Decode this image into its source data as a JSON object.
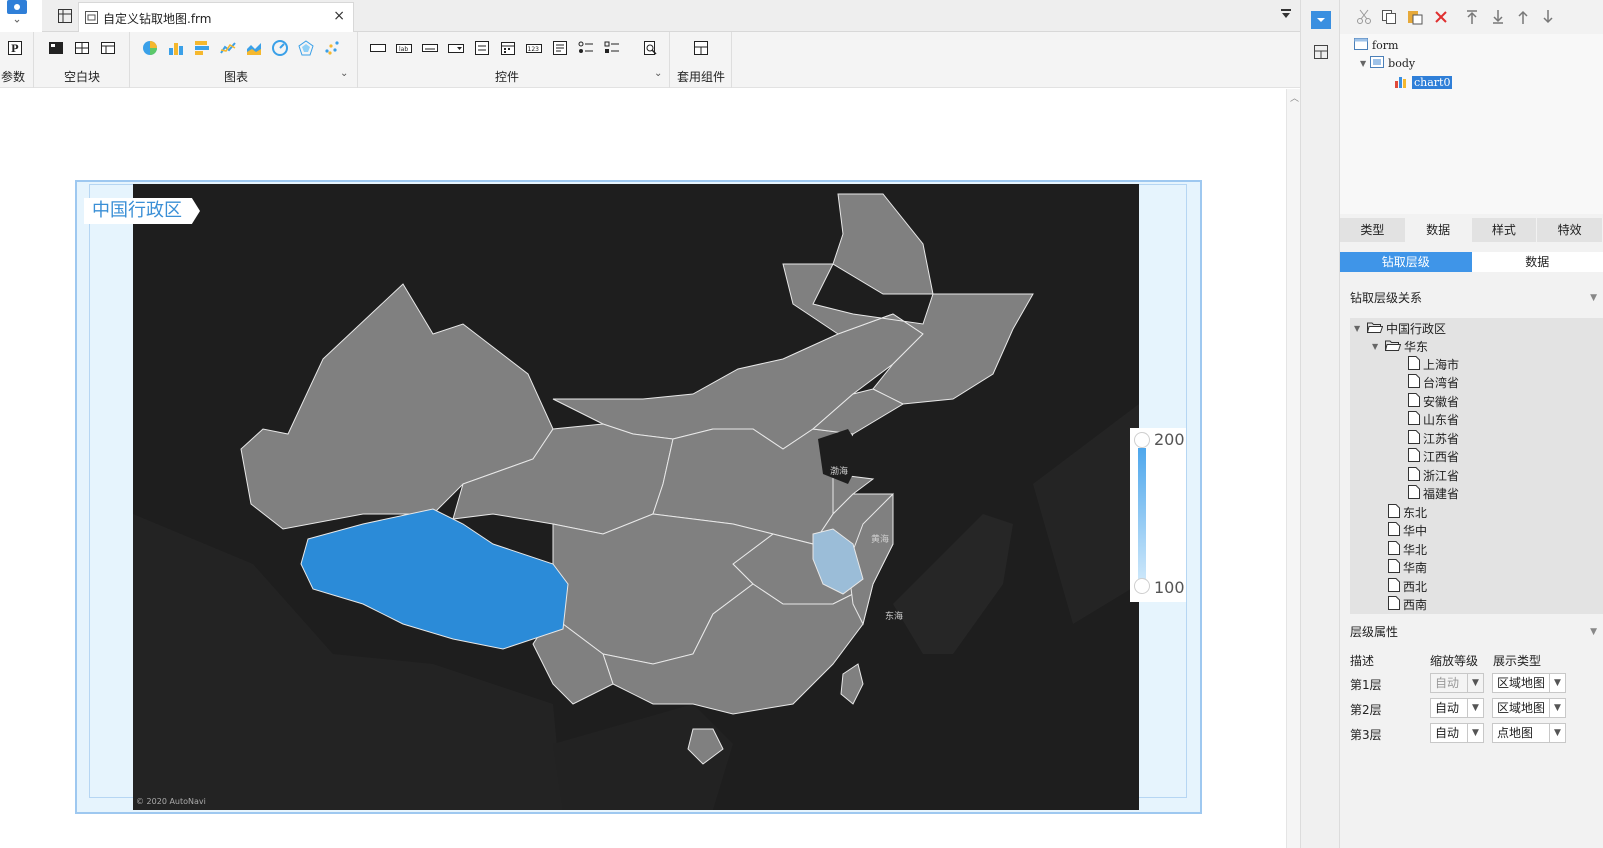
{
  "tab": {
    "title": "自定义钻取地图.frm",
    "close": "×"
  },
  "toolbar": {
    "groups": [
      {
        "label": "参数"
      },
      {
        "label": "空白块"
      },
      {
        "label": "图表",
        "caret": "⌄"
      },
      {
        "label": "控件",
        "caret": "⌄"
      },
      {
        "label": "套用组件"
      }
    ]
  },
  "map": {
    "title": "中国行政区",
    "seas": [
      "渤海",
      "黄海",
      "东海"
    ],
    "footer": "© 2020 AutoNavi",
    "legend": {
      "max": "200",
      "min": "100"
    },
    "colors": {
      "background": "#1e1e1e",
      "province": "#808080",
      "highlight": "#2b8bd8",
      "light": "#9bbdd8"
    }
  },
  "right": {
    "tree": {
      "form": "form",
      "body": "body",
      "chart": "chart0"
    },
    "tabs": [
      "类型",
      "数据",
      "样式",
      "特效"
    ],
    "subtabs": [
      "钻取层级",
      "数据"
    ],
    "drill_section": "钻取层级关系",
    "drill": {
      "root": "中国行政区",
      "east": "华东",
      "east_children": [
        "上海市",
        "台湾省",
        "安徽省",
        "山东省",
        "江苏省",
        "江西省",
        "浙江省",
        "福建省"
      ],
      "others": [
        "东北",
        "华中",
        "华北",
        "华南",
        "西北",
        "西南"
      ]
    },
    "attr_section": "层级属性",
    "attr_headers": [
      "描述",
      "缩放等级",
      "展示类型"
    ],
    "attr_rows": [
      {
        "desc": "第1层",
        "zoom": "自动",
        "type": "区域地图"
      },
      {
        "desc": "第2层",
        "zoom": "自动",
        "type": "区域地图"
      },
      {
        "desc": "第3层",
        "zoom": "自动",
        "type": "点地图"
      }
    ]
  }
}
